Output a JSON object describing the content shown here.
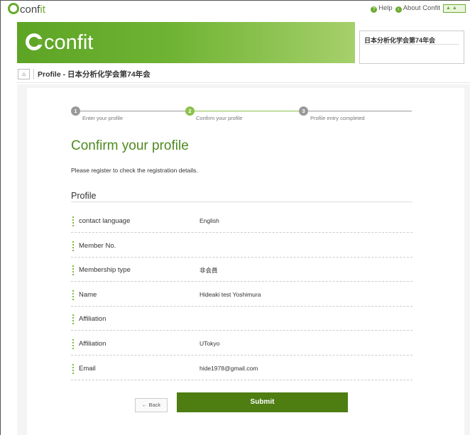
{
  "app": {
    "logo_c": "C",
    "logo_text_a": "conf",
    "logo_text_b": "it",
    "help": "Help",
    "about": "About Confit"
  },
  "banner": {
    "logo_text": "confit",
    "event_box_title": "日本分析化学会第74年会"
  },
  "breadcrumb": {
    "text": "Profile - 日本分析化学会第74年会"
  },
  "steps": [
    {
      "num": "1",
      "label": "Enter your profile"
    },
    {
      "num": "2",
      "label": "Confirm your profile"
    },
    {
      "num": "3",
      "label": "Profile entry completed"
    }
  ],
  "page": {
    "heading": "Confirm your profile",
    "subtitle": "Please register to check the registration details.",
    "section_title": "Profile"
  },
  "fields": [
    {
      "label": "contact language",
      "value": "English"
    },
    {
      "label": "Member No.",
      "value": ""
    },
    {
      "label": "Membership type",
      "value": "非会員"
    },
    {
      "label": "Name",
      "value": "Hideaki test Yoshimura"
    },
    {
      "label": "Affiliation",
      "value": ""
    },
    {
      "label": "Affiliation",
      "value": "UTokyo"
    },
    {
      "label": "Email",
      "value": "hide1978@gmail.com"
    }
  ],
  "actions": {
    "back": "← Back",
    "submit": "Submit"
  },
  "colors": {
    "brand_green": "#6aab2e",
    "heading_green": "#4d8a1f",
    "submit_green": "#4e7d12"
  }
}
